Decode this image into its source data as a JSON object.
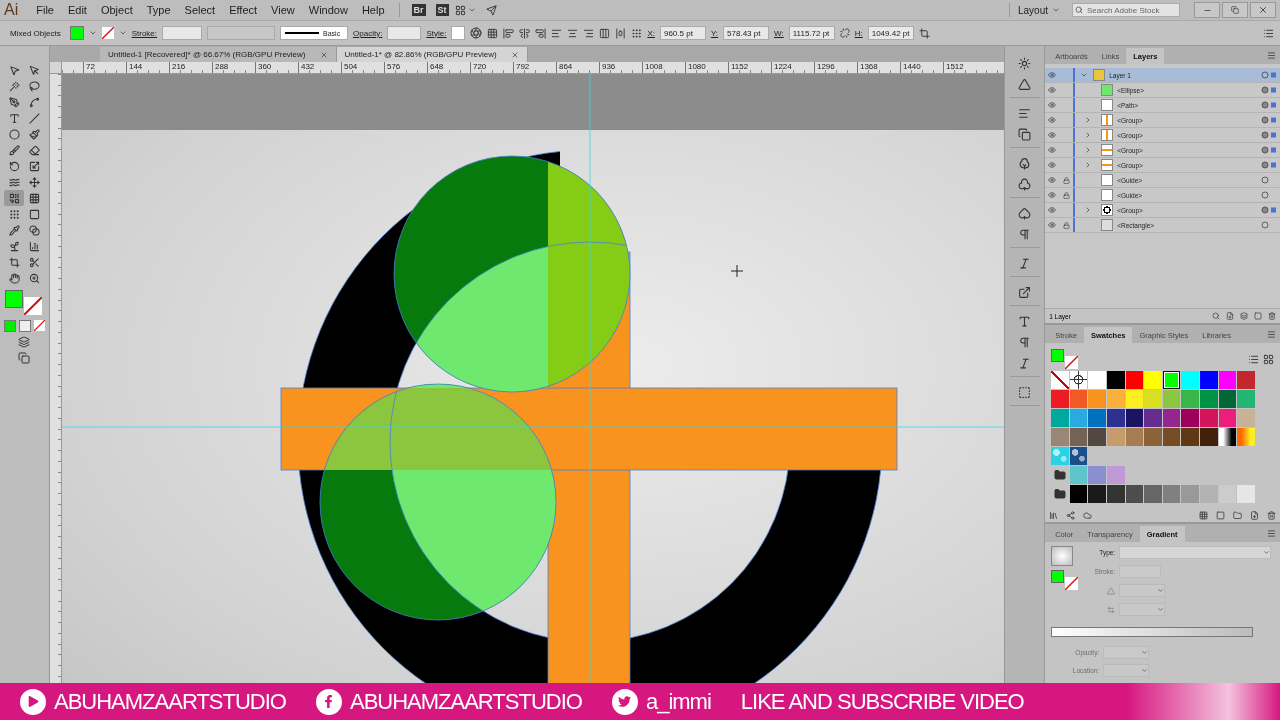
{
  "menu_bar": {
    "logo": "Ai",
    "menus": [
      "File",
      "Edit",
      "Object",
      "Type",
      "Select",
      "Effect",
      "View",
      "Window",
      "Help"
    ],
    "app_buttons": [
      "Br",
      "St"
    ],
    "workspace": "Layout",
    "search": {
      "placeholder": "Search Adobe Stock"
    }
  },
  "control_bar": {
    "selection_label": "Mixed Objects",
    "fill": {
      "color": "#00ff00"
    },
    "stroke_label": "Stroke:",
    "brush": "Basic",
    "opacity_label": "Opacity:",
    "style_label": "Style:",
    "transform": [
      {
        "label": "X:",
        "value": "960.5 pt"
      },
      {
        "label": "Y:",
        "value": "578.43 pt"
      },
      {
        "label": "W:",
        "value": "1115.72 pt"
      },
      {
        "label": "H:",
        "value": "1049.42 pt"
      }
    ]
  },
  "document_tabs": [
    {
      "title": "Untitled-1 [Recovered]* @ 66.67% (RGB/GPU Preview)",
      "selected": false
    },
    {
      "title": "Untitled-1* @ 82.86% (RGB/GPU Preview)",
      "selected": true
    }
  ],
  "ruler": {
    "labels": [
      "72",
      "144",
      "216",
      "288",
      "360",
      "432",
      "504",
      "576",
      "648",
      "720",
      "792",
      "864",
      "936",
      "1008",
      "1080",
      "1152",
      "1224",
      "1296",
      "1368",
      "1440",
      "1512"
    ]
  },
  "toolbar": {
    "fill": {
      "color": "#00ff00"
    },
    "tools": [
      {
        "kind": "selection",
        "selected": false
      },
      {
        "kind": "direct",
        "selected": false
      },
      {
        "kind": "wand",
        "selected": false
      },
      {
        "kind": "lasso",
        "selected": false
      },
      {
        "kind": "pen",
        "selected": false
      },
      {
        "kind": "curvature",
        "selected": false
      },
      {
        "kind": "type",
        "selected": false
      },
      {
        "kind": "line",
        "selected": false
      },
      {
        "kind": "ellipse",
        "selected": false
      },
      {
        "kind": "brush",
        "selected": false
      },
      {
        "kind": "blob",
        "selected": false
      },
      {
        "kind": "eraser",
        "selected": false
      },
      {
        "kind": "rotate",
        "selected": false
      },
      {
        "kind": "scale",
        "selected": false
      },
      {
        "kind": "warp",
        "selected": false
      },
      {
        "kind": "transform",
        "selected": false
      },
      {
        "kind": "shapebuilder",
        "selected": true
      },
      {
        "kind": "perspective",
        "selected": false
      },
      {
        "kind": "mesh",
        "selected": false
      },
      {
        "kind": "gradient",
        "selected": false
      },
      {
        "kind": "eyedropper",
        "selected": false
      },
      {
        "kind": "blend",
        "selected": false
      },
      {
        "kind": "symbol",
        "selected": false
      },
      {
        "kind": "graph",
        "selected": false
      },
      {
        "kind": "artboard",
        "selected": false
      },
      {
        "kind": "slice",
        "selected": false
      },
      {
        "kind": "hand",
        "selected": false
      },
      {
        "kind": "zoom",
        "selected": false
      }
    ]
  },
  "layers_panel": {
    "tabs": [
      {
        "label": "Artboards",
        "selected": false
      },
      {
        "label": "Links",
        "selected": false
      },
      {
        "label": "Layers",
        "selected": true
      }
    ],
    "layers": [
      {
        "name": "Layer 1",
        "visible": true,
        "locked": false,
        "expanded": true,
        "selected": true,
        "children": [
          {
            "name": "<Ellipse>",
            "kind": "ellipse",
            "visible": true,
            "locked": false,
            "selected": true
          },
          {
            "name": "<Path>",
            "kind": "blank",
            "visible": true,
            "locked": false,
            "selected": true
          },
          {
            "name": "<Group>",
            "kind": "vbar",
            "visible": true,
            "locked": false,
            "expanded": false,
            "selected": true
          },
          {
            "name": "<Group>",
            "kind": "vbar",
            "visible": true,
            "locked": false,
            "expanded": false,
            "selected": true
          },
          {
            "name": "<Group>",
            "kind": "hbar",
            "visible": true,
            "locked": false,
            "expanded": false,
            "selected": true
          },
          {
            "name": "<Group>",
            "kind": "hbar",
            "visible": true,
            "locked": false,
            "expanded": false,
            "selected": true
          },
          {
            "name": "<Guide>",
            "kind": "blank",
            "visible": true,
            "locked": true,
            "selected": false
          },
          {
            "name": "<Guide>",
            "kind": "blank",
            "visible": true,
            "locked": true,
            "selected": false
          },
          {
            "name": "<Group>",
            "kind": "ring",
            "visible": true,
            "locked": false,
            "expanded": false,
            "selected": true
          },
          {
            "name": "<Rectangle>",
            "kind": "rect",
            "visible": true,
            "locked": true,
            "selected": false
          }
        ]
      }
    ],
    "footer": "1 Layer"
  },
  "swatches_panel": {
    "tabs": [
      {
        "label": "Stroke",
        "selected": false
      },
      {
        "label": "Swatches",
        "selected": true
      },
      {
        "label": "Graphic Styles",
        "selected": false
      },
      {
        "label": "Libraries",
        "selected": false
      }
    ],
    "fill": {
      "color": "#00ff00"
    },
    "rows": [
      [
        {
          "kind": "none",
          "selected": false
        },
        {
          "kind": "registration",
          "selected": false
        },
        {
          "kind": "color",
          "color": "#ffffff",
          "selected": false
        },
        {
          "kind": "color",
          "color": "#000000",
          "selected": false
        },
        {
          "kind": "color",
          "color": "#ff0000",
          "selected": false
        },
        {
          "kind": "color",
          "color": "#ffff00",
          "selected": false
        },
        {
          "kind": "color",
          "color": "#00ff00",
          "selected": true
        },
        {
          "kind": "color",
          "color": "#00ffff",
          "selected": false
        },
        {
          "kind": "color",
          "color": "#0000ff",
          "selected": false
        },
        {
          "kind": "color",
          "color": "#ff00ff",
          "selected": false
        },
        {
          "kind": "color",
          "color": "#c1272d",
          "selected": false
        }
      ],
      [
        {
          "kind": "color",
          "color": "#ed1c24",
          "selected": false
        },
        {
          "kind": "color",
          "color": "#f15a24",
          "selected": false
        },
        {
          "kind": "color",
          "color": "#f7931e",
          "selected": false
        },
        {
          "kind": "color",
          "color": "#fbb03b",
          "selected": false
        },
        {
          "kind": "color",
          "color": "#fcee21",
          "selected": false
        },
        {
          "kind": "color",
          "color": "#d9e021",
          "selected": false
        },
        {
          "kind": "color",
          "color": "#8cc63f",
          "selected": false
        },
        {
          "kind": "color",
          "color": "#39b54a",
          "selected": false
        },
        {
          "kind": "color",
          "color": "#009245",
          "selected": false
        },
        {
          "kind": "color",
          "color": "#006837",
          "selected": false
        },
        {
          "kind": "color",
          "color": "#22b573",
          "selected": false
        }
      ],
      [
        {
          "kind": "color",
          "color": "#00a99d",
          "selected": false
        },
        {
          "kind": "color",
          "color": "#29abe2",
          "selected": false
        },
        {
          "kind": "color",
          "color": "#0071bc",
          "selected": false
        },
        {
          "kind": "color",
          "color": "#2e3192",
          "selected": false
        },
        {
          "kind": "color",
          "color": "#1b1464",
          "selected": false
        },
        {
          "kind": "color",
          "color": "#662d91",
          "selected": false
        },
        {
          "kind": "color",
          "color": "#93278f",
          "selected": false
        },
        {
          "kind": "color",
          "color": "#9e005d",
          "selected": false
        },
        {
          "kind": "color",
          "color": "#d4145a",
          "selected": false
        },
        {
          "kind": "color",
          "color": "#ed1e79",
          "selected": false
        },
        {
          "kind": "color",
          "color": "#c7b299",
          "selected": false
        }
      ],
      [
        {
          "kind": "color",
          "color": "#998675",
          "selected": false
        },
        {
          "kind": "color",
          "color": "#736357",
          "selected": false
        },
        {
          "kind": "color",
          "color": "#534741",
          "selected": false
        },
        {
          "kind": "color",
          "color": "#c69c6d",
          "selected": false
        },
        {
          "kind": "color",
          "color": "#a67c52",
          "selected": false
        },
        {
          "kind": "color",
          "color": "#8c6239",
          "selected": false
        },
        {
          "kind": "color",
          "color": "#754c24",
          "selected": false
        },
        {
          "kind": "color",
          "color": "#603813",
          "selected": false
        },
        {
          "kind": "color",
          "color": "#42210b",
          "selected": false
        },
        {
          "kind": "gradient",
          "stops": [
            {
              "color": "#ffffff"
            },
            {
              "color": "#000000"
            }
          ],
          "selected": false
        },
        {
          "kind": "gradient",
          "stops": [
            {
              "color": "#ff6a00"
            },
            {
              "color": "#fcee21"
            }
          ],
          "selected": false
        }
      ],
      [
        {
          "kind": "pattern",
          "color": "#29d3e6",
          "selected": false
        },
        {
          "kind": "pattern",
          "color": "#1b4f8a",
          "selected": false
        }
      ],
      [
        {
          "kind": "folder"
        },
        {
          "kind": "color",
          "color": "#5ec5cc",
          "selected": false
        },
        {
          "kind": "color",
          "color": "#8b8fd0",
          "selected": false
        },
        {
          "kind": "color",
          "color": "#c09ad6",
          "selected": false
        }
      ],
      [
        {
          "kind": "folder"
        },
        {
          "kind": "color",
          "color": "#000000",
          "selected": false
        },
        {
          "kind": "color",
          "color": "#1a1a1a",
          "selected": false
        },
        {
          "kind": "color",
          "color": "#333333",
          "selected": false
        },
        {
          "kind": "color",
          "color": "#4d4d4d",
          "selected": false
        },
        {
          "kind": "color",
          "color": "#666666",
          "selected": false
        },
        {
          "kind": "color",
          "color": "#808080",
          "selected": false
        },
        {
          "kind": "color",
          "color": "#999999",
          "selected": false
        },
        {
          "kind": "color",
          "color": "#b3b3b3",
          "selected": false
        },
        {
          "kind": "color",
          "color": "#cccccc",
          "selected": false
        },
        {
          "kind": "color",
          "color": "#e6e6e6",
          "selected": false
        }
      ]
    ]
  },
  "gradient_panel": {
    "tabs": [
      {
        "label": "Color",
        "selected": false
      },
      {
        "label": "Transparency",
        "selected": false
      },
      {
        "label": "Gradient",
        "selected": true
      }
    ],
    "fill": {
      "color": "#00ff00"
    },
    "fields": [
      {
        "kind": "dropdown",
        "label": "Type:",
        "disabled": false
      },
      {
        "kind": "stroke",
        "label": "Stroke:",
        "disabled": true
      },
      {
        "kind": "angle",
        "disabled": true
      },
      {
        "kind": "aspect",
        "disabled": true
      },
      {
        "kind": "slider",
        "disabled": false
      },
      {
        "kind": "dropdown",
        "label": "Opacity:",
        "disabled": true
      },
      {
        "kind": "dropdown",
        "label": "Location:",
        "disabled": true
      }
    ]
  },
  "overlay_banner": [
    {
      "kind": "youtube",
      "text": "ABUHAMZAARTSTUDIO"
    },
    {
      "kind": "facebook",
      "text": "ABUHAMZAARTSTUDIO"
    },
    {
      "kind": "twitter",
      "text": "a_immi"
    },
    {
      "kind": "plain",
      "text": "LIKE AND SUBSCRIBE VIDEO"
    }
  ]
}
